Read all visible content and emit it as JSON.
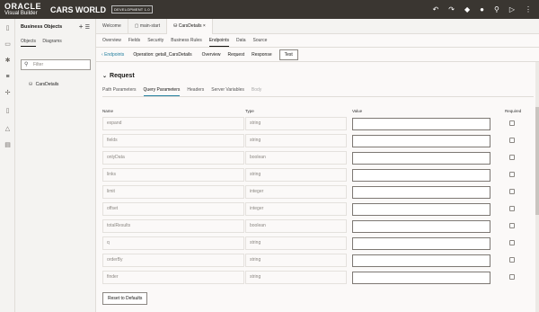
{
  "brand": {
    "line1": "ORACLE",
    "line2": "Visual Builder",
    "app": "CARS WORLD",
    "env": "DEVELOPMENT 1.0"
  },
  "top_icons": [
    "undo-icon",
    "redo-icon",
    "deploy-icon",
    "user-icon",
    "search-icon",
    "play-icon",
    "menu-icon"
  ],
  "panel": {
    "title": "Business Objects",
    "tabs": [
      "Objects",
      "Diagrams"
    ],
    "filter_placeholder": "Filter",
    "items": [
      "CarsDetails"
    ]
  },
  "doc_tabs": [
    "Welcome",
    "main-start",
    "CarsDetails"
  ],
  "sub_tabs": [
    "Overview",
    "Fields",
    "Security",
    "Business Rules",
    "Endpoints",
    "Data",
    "Source"
  ],
  "endpoint_bar": {
    "back": "Endpoints",
    "operation": "Operation: getall_CarsDetails",
    "tabs": [
      "Overview",
      "Request",
      "Response"
    ],
    "test": "Test"
  },
  "request": {
    "title": "Request",
    "tabs": [
      "Path Parameters",
      "Query Parameters",
      "Headers",
      "Server Variables",
      "Body"
    ],
    "columns": {
      "name": "Name",
      "type": "Type",
      "value": "Value",
      "required": "Required"
    },
    "params": [
      {
        "name": "expand",
        "type": "string"
      },
      {
        "name": "fields",
        "type": "string"
      },
      {
        "name": "onlyData",
        "type": "boolean"
      },
      {
        "name": "links",
        "type": "string"
      },
      {
        "name": "limit",
        "type": "integer"
      },
      {
        "name": "offset",
        "type": "integer"
      },
      {
        "name": "totalResults",
        "type": "boolean"
      },
      {
        "name": "q",
        "type": "string"
      },
      {
        "name": "orderBy",
        "type": "string"
      },
      {
        "name": "finder",
        "type": "string"
      }
    ],
    "reset_label": "Reset to Defaults"
  }
}
